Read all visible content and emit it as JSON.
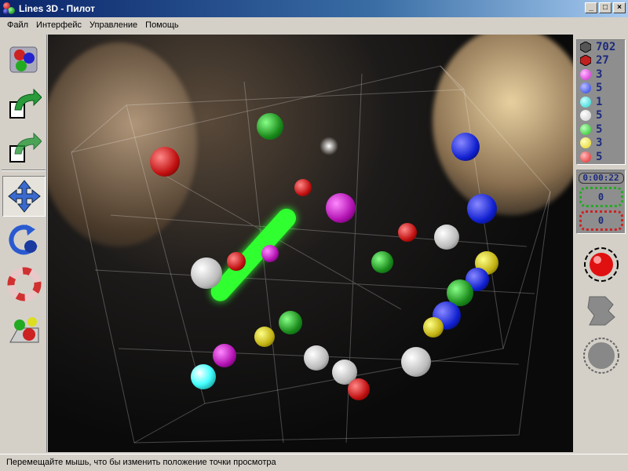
{
  "window": {
    "title": "Lines 3D - Пилот",
    "minimize": "_",
    "maximize": "□",
    "close": "×"
  },
  "menu": [
    "Файл",
    "Интерфейс",
    "Управление",
    "Помощь"
  ],
  "toolbar": [
    "new-game",
    "undo",
    "redo",
    "move-view",
    "rotate",
    "help",
    "settings"
  ],
  "counts": [
    {
      "icon": "total-cells-icon",
      "color": "#444444",
      "value": "702"
    },
    {
      "icon": "cube-icon",
      "color": "#c02020",
      "value": "27"
    },
    {
      "icon": "magenta-ball-icon",
      "color": "#d020d0",
      "value": "3"
    },
    {
      "icon": "blue-ball-icon",
      "color": "#2040e0",
      "value": "5"
    },
    {
      "icon": "cyan-ball-icon",
      "color": "#20d0d0",
      "value": "1"
    },
    {
      "icon": "white-ball-icon",
      "color": "#f0f0f0",
      "value": "5"
    },
    {
      "icon": "green-ball-icon",
      "color": "#20c020",
      "value": "5"
    },
    {
      "icon": "yellow-ball-icon",
      "color": "#e0d020",
      "value": "3"
    },
    {
      "icon": "red-ball-icon",
      "color": "#e02020",
      "value": "5"
    }
  ],
  "timer": "0:00:22",
  "score_green": "0",
  "score_red": "0",
  "status": "Перемещайте мышь, что бы изменить положение точки просмотра"
}
